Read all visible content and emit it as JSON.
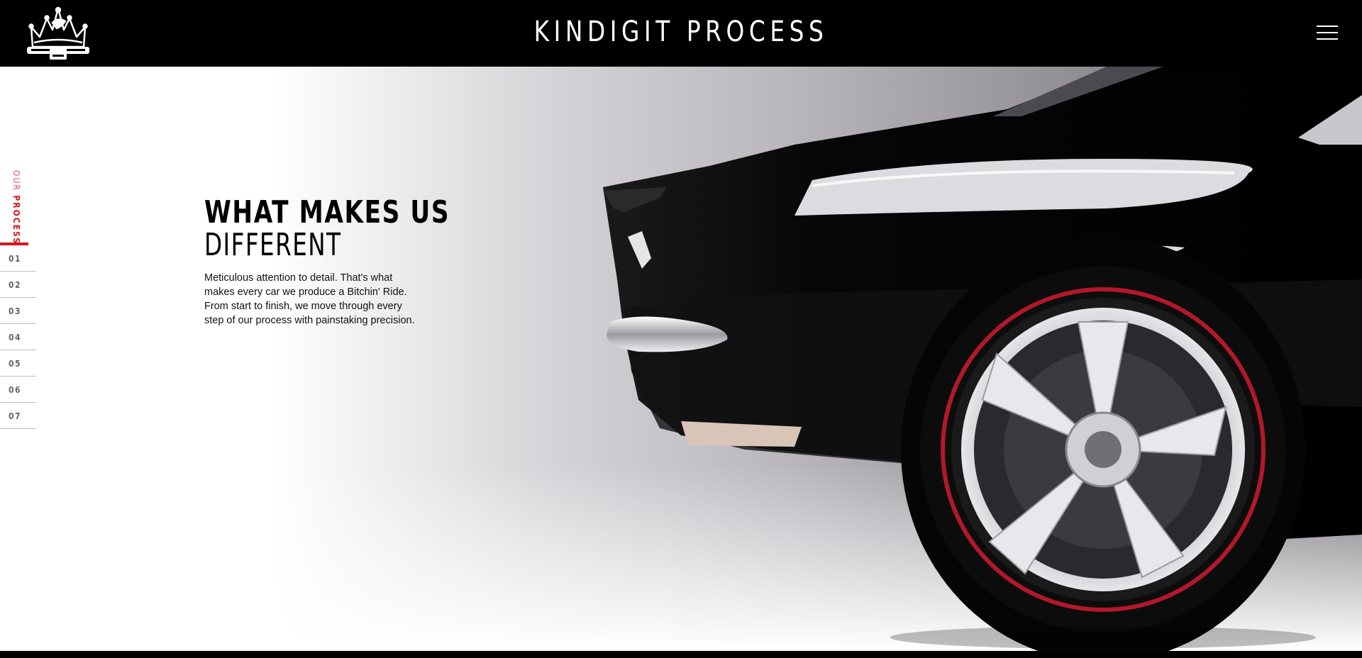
{
  "header": {
    "title": "KINDIGIT PROCESS",
    "logo_icon": "crown-logo-icon",
    "menu_icon": "hamburger-menu-icon"
  },
  "sidenav": {
    "label_light": "OUR",
    "label_bold": "PROCESS",
    "steps": [
      "01",
      "02",
      "03",
      "04",
      "05",
      "06",
      "07"
    ],
    "active_color": "#d4141c"
  },
  "hero": {
    "heading_bold": "WHAT MAKES US",
    "heading_light": "DIFFERENT",
    "description": "Meticulous attention to detail. That's what makes every car we produce a Bitchin' Ride. From start to finish, we move through every step of our process with painstaking precision.",
    "image": "black-classic-car-rear-wheel-image"
  },
  "colors": {
    "header_bg": "#000000",
    "accent": "#d4141c",
    "tire_stripe": "#b3182a"
  }
}
